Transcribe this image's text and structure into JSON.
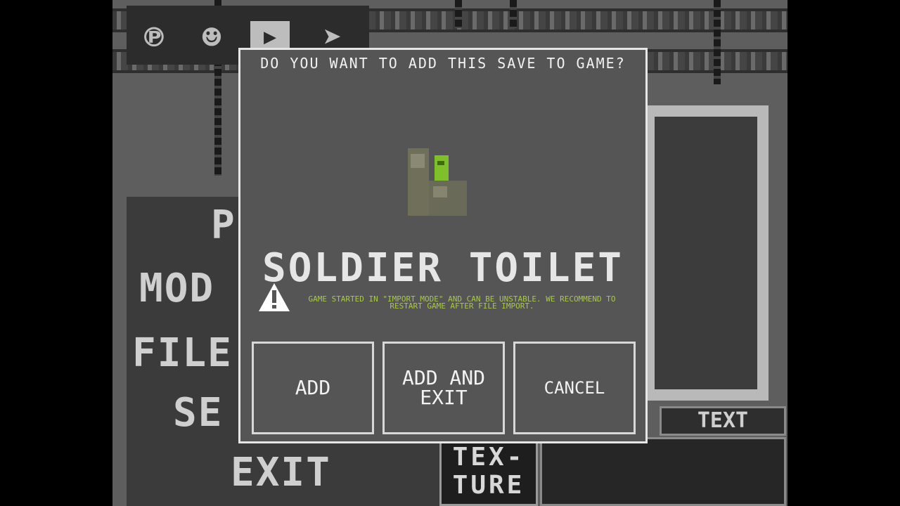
{
  "background": {
    "social_icons": [
      "patreon-icon",
      "discord-icon",
      "youtube-icon",
      "telegram-icon"
    ],
    "menu_items": [
      "P",
      "MOD",
      "FILE",
      "SE",
      "EXIT"
    ],
    "text_label": "TEXT",
    "texture_tile": "TEX-TURE"
  },
  "dialog": {
    "question": "DO YOU WANT TO ADD THIS SAVE TO GAME?",
    "save_name": "SOLDIER TOILET",
    "warning_icon": "warning-icon",
    "warning_text": "GAME STARTED IN \"IMPORT MODE\" AND CAN BE UNSTABLE. WE RECOMMEND TO RESTART GAME AFTER FILE IMPORT.",
    "buttons": {
      "add": "ADD",
      "add_and_exit": "ADD AND EXIT",
      "cancel": "CANCEL"
    },
    "warning_color": "#a8c84a"
  }
}
